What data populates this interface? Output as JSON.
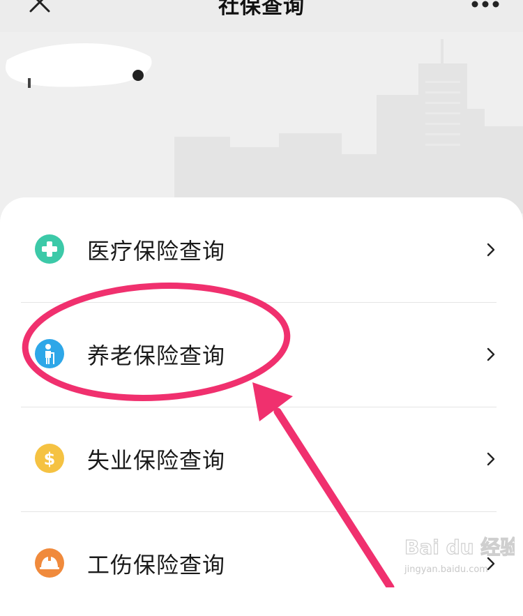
{
  "header": {
    "title": "社保查询",
    "close_icon": "close-icon",
    "more_icon": "more-icon"
  },
  "menu": {
    "items": [
      {
        "label": "医疗保险查询",
        "icon": "medical-cross-icon",
        "icon_color": "#3cc9a8"
      },
      {
        "label": "养老保险查询",
        "icon": "elderly-person-icon",
        "icon_color": "#2ea7e8"
      },
      {
        "label": "失业保险查询",
        "icon": "dollar-icon",
        "icon_color": "#f5c242"
      },
      {
        "label": "工伤保险查询",
        "icon": "helmet-icon",
        "icon_color": "#f08a3c"
      }
    ],
    "chevron_icon": "chevron-right-icon"
  },
  "annotation": {
    "color": "#f0306e",
    "shapes": [
      "highlight-ellipse",
      "pointer-arrow"
    ]
  },
  "watermark": {
    "brand": "Bai du 经验",
    "url": "jingyan.baidu.com"
  }
}
